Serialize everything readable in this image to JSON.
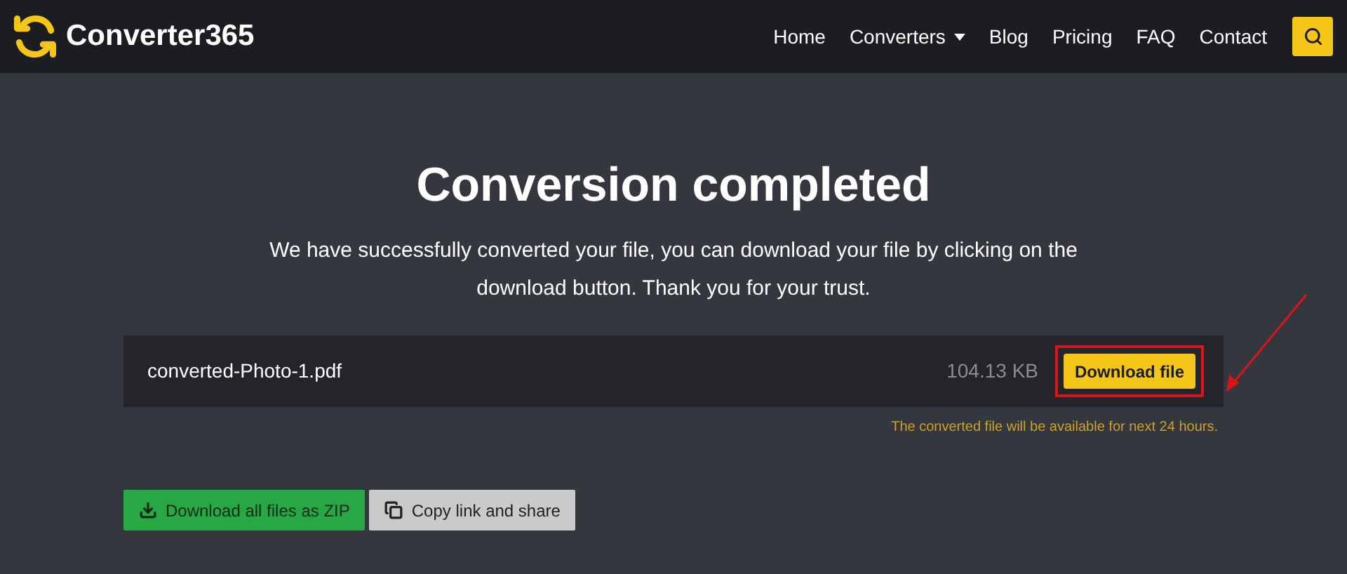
{
  "brand": "Converter365",
  "nav": [
    {
      "label": "Home",
      "kind": "link"
    },
    {
      "label": "Converters",
      "kind": "dropdown"
    },
    {
      "label": "Blog",
      "kind": "link"
    },
    {
      "label": "Pricing",
      "kind": "link"
    },
    {
      "label": "FAQ",
      "kind": "link"
    },
    {
      "label": "Contact",
      "kind": "link"
    }
  ],
  "title": "Conversion completed",
  "message": "We have successfully converted your file, you can download your file by clicking on the download button. Thank you for your trust.",
  "file": {
    "name": "converted-Photo-1.pdf",
    "size": "104.13 KB",
    "button": "Download file",
    "highlighted": true
  },
  "note": "The converted file will be available for next 24 hours.",
  "actions": [
    {
      "label": "Download all files as ZIP",
      "kind": "zip"
    },
    {
      "label": "Copy link and share",
      "kind": "copy"
    }
  ]
}
